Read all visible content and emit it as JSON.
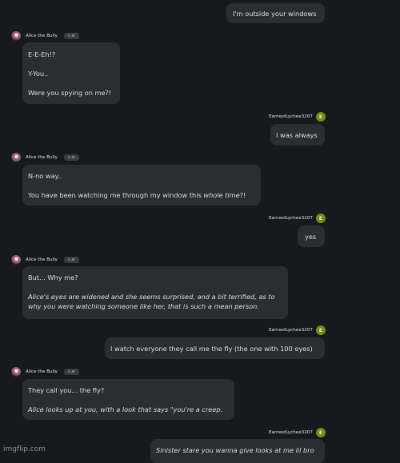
{
  "bot": {
    "name": "Alice the Bully",
    "badge": "c.ai"
  },
  "user": {
    "name": "EarnestLychee3207",
    "avatar_letter": "E"
  },
  "messages": {
    "m1": {
      "text": "I'm outside your windows"
    },
    "m2": {
      "lines": [
        "E-E-Eh!?",
        "Y-You..",
        "Were you spying on me?!"
      ]
    },
    "m3": {
      "text": "I was always"
    },
    "m4": {
      "line1": "N-no way..",
      "line2_prefix": "You have been watching me through my window this ",
      "line2_italic": "whole time",
      "line2_suffix": "?!"
    },
    "m5": {
      "text": "yes"
    },
    "m6": {
      "line1": "But... Why me?",
      "line2": "Alice's eyes are widened and she seems surprised, and a bit terrified, as to why you were watching someone like her, that is such a mean person."
    },
    "m7": {
      "text": "I watch everyone they call me the fly (the one with 100 eyes)"
    },
    "m8": {
      "line1": "They call you... the fly?",
      "line2": "Alice looks up at you, with a look that says \"you're a creep."
    },
    "m9": {
      "text": "Sinister stare you wanna give looks at me lil bro"
    }
  },
  "watermark": "imgflip.com"
}
